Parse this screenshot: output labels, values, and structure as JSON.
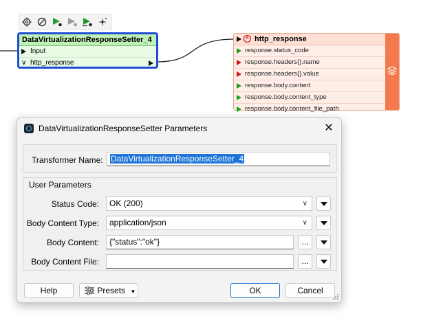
{
  "toolbar": {
    "icons": [
      "gear-icon",
      "disable-icon",
      "run-to-this-icon",
      "run-just-this-icon",
      "run-from-this-icon",
      "quick-add-icon"
    ]
  },
  "transformer": {
    "title": "DataVirtualizationResponseSetter_4",
    "input_port": "Input",
    "output_port": "http_response"
  },
  "feature_type": {
    "title": "http_response",
    "attributes": [
      {
        "name": "response.status_code",
        "color": "#17a11a"
      },
      {
        "name": "response.headers{}.name",
        "color": "#c8131a"
      },
      {
        "name": "response.headers{}.value",
        "color": "#c8131a"
      },
      {
        "name": "response.body.content",
        "color": "#17a11a"
      },
      {
        "name": "response.body.content_type",
        "color": "#17a11a"
      },
      {
        "name": "response.body.content_file_path",
        "color": "#17a11a"
      }
    ]
  },
  "dialog": {
    "title": "DataVirtualizationResponseSetter Parameters",
    "transformer_name_label": "Transformer Name:",
    "transformer_name_value": "DataVirtualizationResponseSetter_4",
    "user_params_heading": "User Parameters",
    "status_code_label": "Status Code:",
    "status_code_value": "OK (200)",
    "body_content_type_label": "Body Content Type:",
    "body_content_type_value": "application/json",
    "body_content_label": "Body Content:",
    "body_content_value": "{\"status\":\"ok\"}",
    "body_content_file_label": "Body Content File:",
    "body_content_file_value": "",
    "ellipsis": "...",
    "help_label": "Help",
    "presets_label": "Presets",
    "ok_label": "OK",
    "cancel_label": "Cancel"
  },
  "colors": {
    "node_border": "#1d4fd6",
    "node_title_bg": "#bff0b5",
    "feature_type_accent": "#f47a4e",
    "attr_ok": "#17a11a",
    "attr_missing": "#c8131a"
  }
}
